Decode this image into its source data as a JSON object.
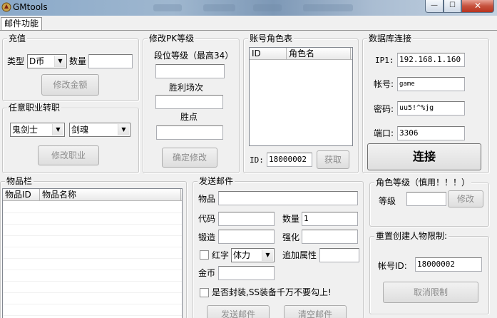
{
  "window": {
    "title": "GMtools",
    "close_glyph": "✕",
    "min_glyph": "—",
    "max_glyph": "☐"
  },
  "tabs": [
    {
      "label": "邮件功能"
    }
  ],
  "recharge": {
    "title": "充值",
    "type_label": "类型",
    "type_value": "D币",
    "qty_label": "数量",
    "qty_value": "",
    "submit": "修改金额"
  },
  "job_transfer": {
    "title": "任意职业转职",
    "class_value": "鬼剑士",
    "subclass_value": "剑魂",
    "submit": "修改职业"
  },
  "pk_level": {
    "title": "修改PK等级",
    "rank_label": "段位等级（最高34）",
    "rank_value": "",
    "wins_label": "胜利场次",
    "wins_value": "",
    "points_label": "胜点",
    "points_value": "",
    "submit": "确定修改"
  },
  "account_roles": {
    "title": "账号角色表",
    "columns": [
      "ID",
      "角色名"
    ],
    "id_label": "ID:",
    "id_value": "18000002",
    "submit": "获取"
  },
  "db_connect": {
    "title": "数据库连接",
    "ip_label": "IP1:",
    "ip_value": "192.168.1.160",
    "account_label": "帐号:",
    "account_value": "game",
    "password_label": "密码:",
    "password_value": "uu5!^%jg",
    "port_label": "端口:",
    "port_value": "3306",
    "submit": "连接"
  },
  "items": {
    "title": "物品栏",
    "columns": [
      "物品ID",
      "物品名称"
    ]
  },
  "send_mail": {
    "title": "发送邮件",
    "item_label": "物品",
    "item_value": "",
    "code_label": "代码",
    "code_value": "",
    "qty_label": "数量",
    "qty_value": "1",
    "forge_label": "锻造",
    "forge_value": "",
    "enhance_label": "强化",
    "enhance_value": "",
    "red_label": "红字",
    "red_select": "体力",
    "extra_label": "追加属性",
    "extra_value": "",
    "gold_label": "金币",
    "gold_value": "",
    "seal_label": "是否封装,SS装备千万不要勾上!",
    "send": "发送邮件",
    "clear": "清空邮件"
  },
  "role_level": {
    "title": "角色等级（慎用！！！）",
    "level_label": "等级",
    "level_value": "",
    "submit": "修改"
  },
  "reset_limit": {
    "title": "重置创建人物限制:",
    "account_label": "帐号ID:",
    "account_value": "18000002",
    "submit": "取消限制"
  }
}
